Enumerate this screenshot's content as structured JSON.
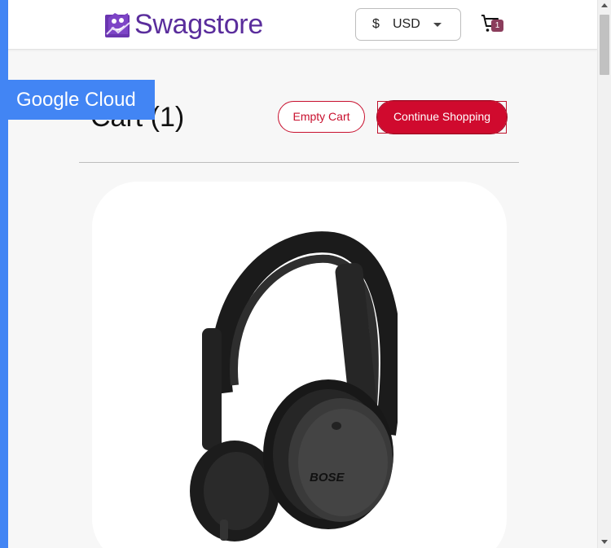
{
  "header": {
    "brand": "Swagstore",
    "currency_symbol": "$",
    "currency_code": "USD",
    "cart_count": "1"
  },
  "banner": {
    "label": "Google Cloud"
  },
  "cart": {
    "title": "Cart (1)",
    "empty_label": "Empty Cart",
    "continue_label": "Continue Shopping"
  },
  "product": {
    "image_name": "headphones-image",
    "brand_mark": "BOSE"
  },
  "colors": {
    "brand_purple": "#5a2d9c",
    "accent_red": "#d00a2e",
    "banner_blue": "#4285f4",
    "badge": "#8b3d5c"
  }
}
